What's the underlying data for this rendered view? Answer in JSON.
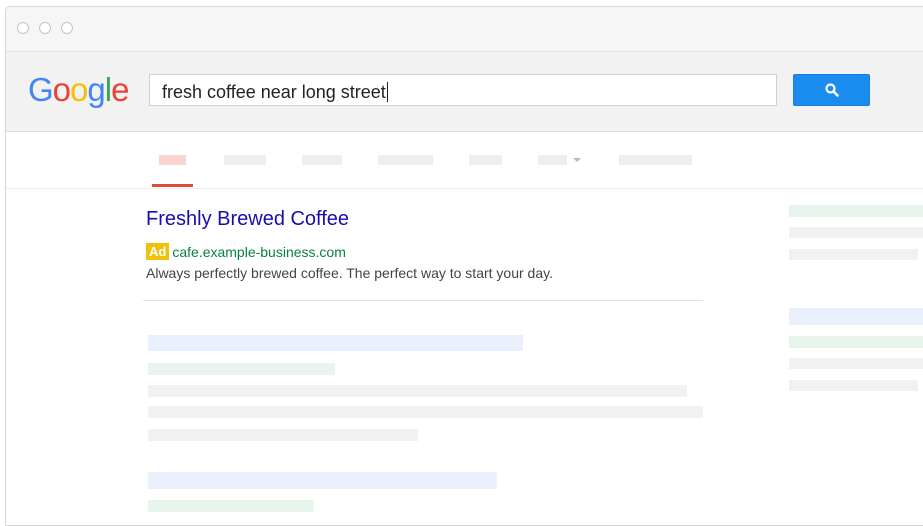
{
  "window": {
    "controls": [
      "close",
      "minimize",
      "maximize"
    ]
  },
  "header": {
    "logo_letters": [
      {
        "ch": "G",
        "color": "#4285F4"
      },
      {
        "ch": "o",
        "color": "#EA4335"
      },
      {
        "ch": "o",
        "color": "#FBBC05"
      },
      {
        "ch": "g",
        "color": "#4285F4"
      },
      {
        "ch": "l",
        "color": "#34A853"
      },
      {
        "ch": "e",
        "color": "#EA4335"
      }
    ],
    "search": {
      "value": "fresh coffee near long street"
    },
    "search_button": {
      "icon": "search-icon",
      "color": "#1a8cf0"
    }
  },
  "tabs": {
    "active_index": 0,
    "accent_color": "#dd4b39"
  },
  "ad_result": {
    "title": "Freshly Brewed Coffee",
    "badge": "Ad",
    "badge_color": "#f0c20d",
    "url": "cafe.example-business.com",
    "description": "Always perfectly brewed coffee. The perfect way to start your day.",
    "title_color": "#1a0dab",
    "url_color": "#0b8043"
  }
}
